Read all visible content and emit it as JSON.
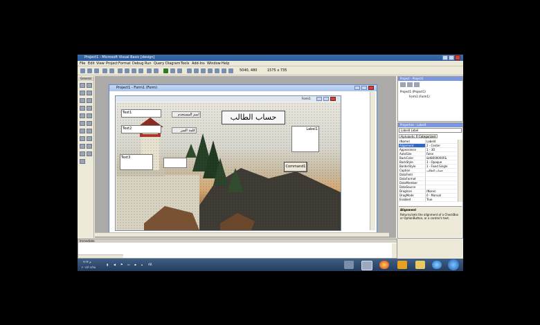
{
  "window": {
    "title": "Project1 - Microsoft Visual Basic [design]"
  },
  "menu": [
    "File",
    "Edit",
    "View",
    "Project",
    "Format",
    "Debug",
    "Run",
    "Query",
    "Diagram",
    "Tools",
    "Add-Ins",
    "Window",
    "Help"
  ],
  "toolbar": {
    "position": "5040, 480",
    "size": "1575 x 735"
  },
  "toolbox": {
    "title": "General"
  },
  "form_window": {
    "title": "Project1 - Form1 (Form)",
    "inner_title": "Form1"
  },
  "controls": {
    "text1": "Text1",
    "text2": "Text2",
    "text3": "Text3",
    "label_name": "اسم المستخدم",
    "label_password": "كلمة السر",
    "heading": "حساب الطالب",
    "label1": "Label1",
    "command1": "Command1"
  },
  "project_panel": {
    "title": "Project - Project1",
    "tree": [
      "Project1 (Project1)",
      "Form1 (Form1)"
    ]
  },
  "properties_panel": {
    "title": "Properties - Label4",
    "object": "Label4 Label",
    "tabs": [
      "Alphabetic",
      "Categorized"
    ],
    "rows": [
      {
        "name": "(Name)",
        "value": "Label4"
      },
      {
        "name": "Alignment",
        "value": "2 - Center"
      },
      {
        "name": "Appearance",
        "value": "1 - 3D"
      },
      {
        "name": "AutoSize",
        "value": "False"
      },
      {
        "name": "BackColor",
        "value": "&H8000000F&"
      },
      {
        "name": "BackStyle",
        "value": "1 - Opaque"
      },
      {
        "name": "BorderStyle",
        "value": "1 - Fixed Single"
      },
      {
        "name": "Caption",
        "value": "حساب الطالب"
      },
      {
        "name": "DataField",
        "value": ""
      },
      {
        "name": "DataFormat",
        "value": ""
      },
      {
        "name": "DataMember",
        "value": ""
      },
      {
        "name": "DataSource",
        "value": ""
      },
      {
        "name": "DragIcon",
        "value": "(None)"
      },
      {
        "name": "DragMode",
        "value": "0 - Manual"
      },
      {
        "name": "Enabled",
        "value": "True"
      }
    ],
    "desc_title": "Alignment",
    "desc_text": "Returns/sets the alignment of a CheckBox or OptionButton, or a control's text."
  },
  "immediate": {
    "title": "Immediate"
  },
  "taskbar": {
    "time": "م ٩:٢٣",
    "date": "٢٠١٣/٠٢/٢٥",
    "lang": "AR"
  },
  "colors": {
    "titlebar": "#2b5aa0",
    "selection": "#316ac5",
    "taskbar": "#253c5c"
  }
}
